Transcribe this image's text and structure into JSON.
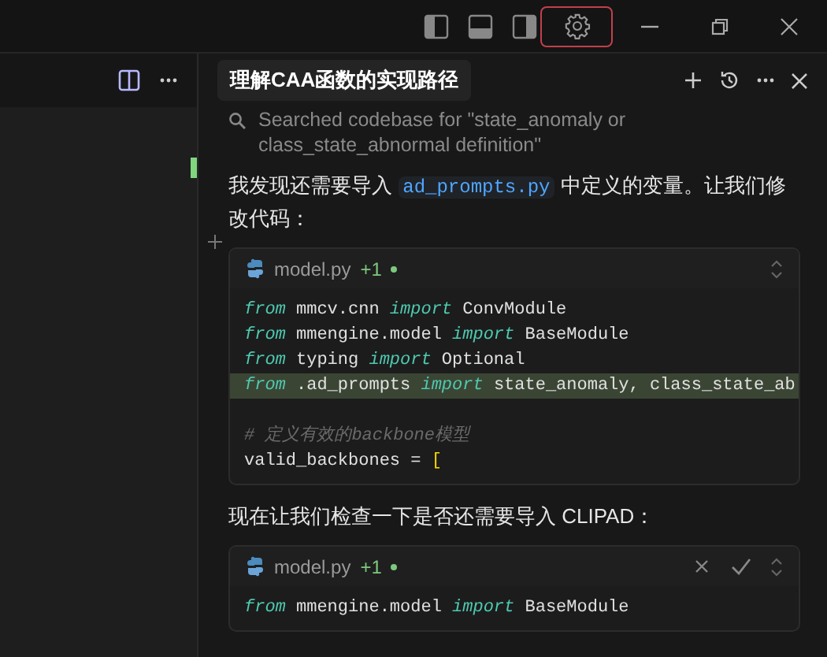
{
  "titlebar": {
    "layout_buttons": [
      {
        "kind": "left",
        "selected": false
      },
      {
        "kind": "bottom",
        "selected": false
      },
      {
        "kind": "right",
        "selected": false
      }
    ],
    "settings": {
      "selected": true
    }
  },
  "chat": {
    "title": "理解CAA函数的实现路径",
    "messages": [
      {
        "kind": "search",
        "text": "Searched codebase for \"state_anomaly or class_state_abnormal definition\""
      },
      {
        "kind": "paragraph",
        "parts": [
          {
            "kind": "text",
            "text": "我发现还需要导入 "
          },
          {
            "kind": "code",
            "text": "ad_prompts.py"
          },
          {
            "kind": "text",
            "text": " 中定义的变量。让我们修改代码："
          }
        ]
      },
      {
        "kind": "code_block",
        "file": "model.py",
        "badge": "+1",
        "actions": false,
        "lines": [
          {
            "highlighted": false,
            "tokens": [
              {
                "kind": "kw",
                "text": "from"
              },
              {
                "kind": "plain",
                "text": " mmcv.cnn "
              },
              {
                "kind": "kw",
                "text": "import"
              },
              {
                "kind": "plain",
                "text": " ConvModule"
              }
            ]
          },
          {
            "highlighted": false,
            "tokens": [
              {
                "kind": "kw",
                "text": "from"
              },
              {
                "kind": "plain",
                "text": " mmengine.model "
              },
              {
                "kind": "kw",
                "text": "import"
              },
              {
                "kind": "plain",
                "text": " BaseModule"
              }
            ]
          },
          {
            "highlighted": false,
            "tokens": [
              {
                "kind": "kw",
                "text": "from"
              },
              {
                "kind": "plain",
                "text": " typing "
              },
              {
                "kind": "kw",
                "text": "import"
              },
              {
                "kind": "plain",
                "text": " Optional"
              }
            ]
          },
          {
            "highlighted": true,
            "tokens": [
              {
                "kind": "kw",
                "text": "from"
              },
              {
                "kind": "plain",
                "text": " .ad_prompts "
              },
              {
                "kind": "kw",
                "text": "import"
              },
              {
                "kind": "plain",
                "text": " state_anomaly, class_state_ab"
              }
            ]
          },
          {
            "highlighted": false
          },
          {
            "highlighted": false,
            "tokens": [
              {
                "kind": "comment",
                "text": "# 定义有效的backbone模型"
              }
            ]
          },
          {
            "highlighted": false,
            "tokens": [
              {
                "kind": "plain",
                "text": "valid_backbones = "
              },
              {
                "kind": "bracket",
                "text": "["
              }
            ]
          }
        ]
      },
      {
        "kind": "paragraph",
        "parts": [
          {
            "kind": "text",
            "text": "现在让我们检查一下是否还需要导入 CLIPAD："
          }
        ]
      },
      {
        "kind": "code_block",
        "file": "model.py",
        "badge": "+1",
        "actions": true,
        "lines": [
          {
            "highlighted": false,
            "tokens": [
              {
                "kind": "kw",
                "text": "from"
              },
              {
                "kind": "plain",
                "text": " mmengine.model "
              },
              {
                "kind": "kw",
                "text": "import"
              },
              {
                "kind": "plain",
                "text": " BaseModule"
              }
            ]
          }
        ]
      }
    ]
  }
}
